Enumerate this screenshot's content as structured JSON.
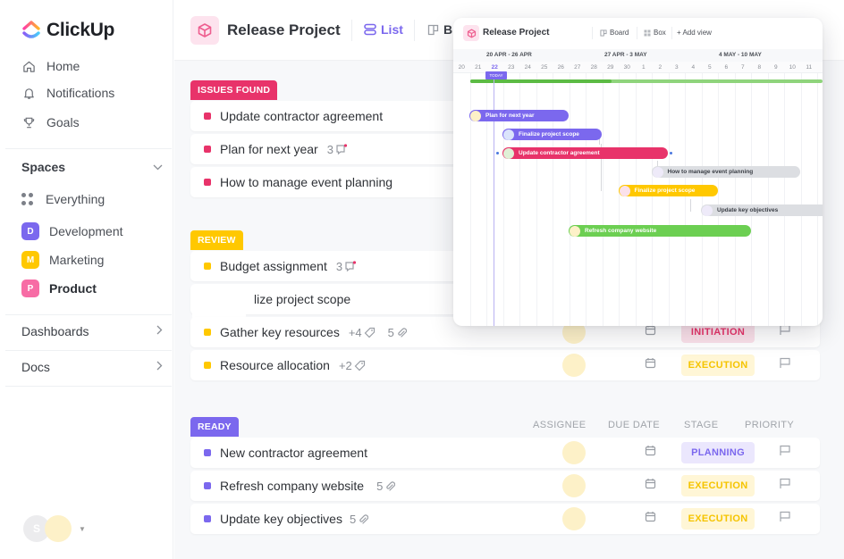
{
  "app": {
    "name": "ClickUp"
  },
  "sidebar": {
    "nav": [
      {
        "label": "Home",
        "icon": "home-icon"
      },
      {
        "label": "Notifications",
        "icon": "bell-icon"
      },
      {
        "label": "Goals",
        "icon": "trophy-icon"
      }
    ],
    "spaces_header": "Spaces",
    "spaces": [
      {
        "label": "Everything",
        "badge": "",
        "color": ""
      },
      {
        "label": "Development",
        "badge": "D",
        "color": "#7b68ee"
      },
      {
        "label": "Marketing",
        "badge": "M",
        "color": "#ffc800"
      },
      {
        "label": "Product",
        "badge": "P",
        "color": "#f76ca5"
      }
    ],
    "dashboards": "Dashboards",
    "docs": "Docs",
    "user_initial": "S"
  },
  "header": {
    "project_title": "Release Project",
    "views": [
      {
        "label": "List",
        "active": true
      },
      {
        "label": "B",
        "active": false
      }
    ]
  },
  "columns": {
    "assignee": "ASSIGNEE",
    "due_date": "DUE DATE",
    "stage": "STAGE",
    "priority": "PRIORITY"
  },
  "groups": [
    {
      "label": "ISSUES FOUND",
      "color": "#e8336a",
      "tasks": [
        {
          "name": "Update contractor agreement",
          "meta": []
        },
        {
          "name": "Plan for next year",
          "meta": [
            {
              "value": "3",
              "icon": "comment-icon"
            }
          ]
        },
        {
          "name": "How to manage event planning",
          "meta": []
        }
      ]
    },
    {
      "label": "REVIEW",
      "color": "#ffc800",
      "tasks": [
        {
          "name": "Budget assignment",
          "meta": [
            {
              "value": "3",
              "icon": "comment-icon"
            }
          ]
        },
        {
          "name": "lize project scope",
          "meta": []
        },
        {
          "name": "Gather key resources",
          "meta": [
            {
              "value": "+4",
              "icon": "tag-icon"
            },
            {
              "value": "5",
              "icon": "paperclip-icon"
            }
          ],
          "stage": "INITIATION"
        },
        {
          "name": "Resource allocation",
          "meta": [
            {
              "value": "+2",
              "icon": "tag-icon"
            }
          ],
          "stage": "EXECUTION"
        }
      ]
    },
    {
      "label": "READY",
      "color": "#7b68ee",
      "tasks": [
        {
          "name": "New contractor agreement",
          "meta": [],
          "stage": "PLANNING"
        },
        {
          "name": "Refresh company website",
          "meta": [
            {
              "value": "5",
              "icon": "paperclip-icon"
            }
          ],
          "stage": "EXECUTION"
        },
        {
          "name": "Update key objectives",
          "meta": [
            {
              "value": "5",
              "icon": "paperclip-icon"
            }
          ],
          "stage": "EXECUTION"
        }
      ]
    }
  ],
  "stage_colors": {
    "INITIATION": {
      "bg": "#fbe1ea",
      "fg": "#e8336a"
    },
    "EXECUTION": {
      "bg": "#fff6d6",
      "fg": "#f5c400"
    },
    "PLANNING": {
      "bg": "#ebe7fd",
      "fg": "#7b68ee"
    }
  },
  "gantt": {
    "title": "Release Project",
    "tabs": [
      "Board",
      "Box",
      "+ Add view"
    ],
    "weeks": [
      "20 APR - 26 APR",
      "27 APR - 3 MAY",
      "4 MAY - 10 MAY"
    ],
    "days": [
      "20",
      "21",
      "22",
      "23",
      "24",
      "25",
      "26",
      "27",
      "28",
      "29",
      "30",
      "1",
      "2",
      "3",
      "4",
      "5",
      "6",
      "7",
      "8",
      "9",
      "10",
      "11"
    ],
    "today_index": 2,
    "today_label": "TODAY",
    "progress": 0.4,
    "bars": [
      {
        "label": "Plan for next year",
        "start": 0,
        "span": 6,
        "color": "#7b68ee",
        "avatar": "#fdf1c8"
      },
      {
        "label": "Finalize project scope",
        "start": 2,
        "span": 6,
        "color": "#7b68ee",
        "avatar": "#dbe4fb"
      },
      {
        "label": "Update contractor agreement",
        "start": 2,
        "span": 10,
        "color": "#e8336a",
        "avatar": "#dff0d6"
      },
      {
        "label": "How to manage event planning",
        "start": 11,
        "span": 9,
        "color": "#dcdee2",
        "avatar": "#eeeaf9",
        "grey": true
      },
      {
        "label": "Finalize project scope",
        "start": 9,
        "span": 6,
        "color": "#ffc800",
        "avatar": "#fbe1ea"
      },
      {
        "label": "Update key objectives",
        "start": 14,
        "span": 8,
        "color": "#dcdee2",
        "avatar": "#eeeaf9",
        "grey": true
      },
      {
        "label": "Refresh company website",
        "start": 6,
        "span": 11,
        "color": "#6ccf52",
        "avatar": "#fdf1c8"
      }
    ]
  }
}
